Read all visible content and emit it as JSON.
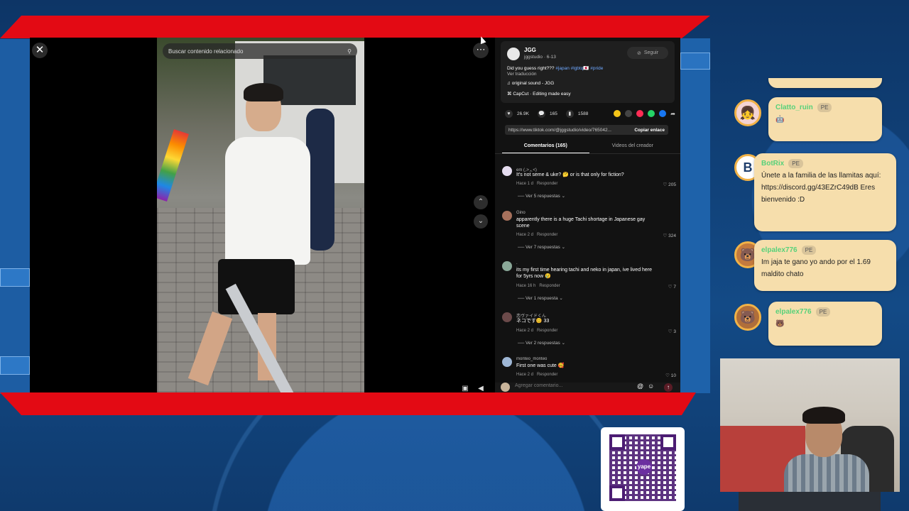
{
  "player": {
    "search_placeholder": "Buscar contenido relacionado",
    "close_icon": "✕",
    "more_icon": "⋯",
    "nav_up_icon": "⌃",
    "nav_down_icon": "⌄"
  },
  "post": {
    "author": "JGG",
    "handle_date": "jggstudio · 6-13",
    "follow_label": "Seguir",
    "caption": "Did you guess right???",
    "hashtags": "#japan #lgbtq🇯🇵 #pride",
    "translate": "Ver traducción",
    "sound": "original sound - JGG",
    "capcut": "CapCut · Editing made easy",
    "likes": "26.9K",
    "comments": "165",
    "saves": "1588",
    "link": "https://www.tiktok.com/@jggstudio/video/765042...",
    "copy_label": "Copiar enlace"
  },
  "tabs": [
    "Comentarios (165)",
    "Videos del creador"
  ],
  "comments": [
    {
      "user": "em (◞˃ᆺ˂)",
      "text": "It's not seme & uke? 🤔 or is that only for fiction?",
      "meta": "Hace 1 d",
      "reply": "Responder",
      "likes": "205",
      "replies": "Ver 5 respuestas"
    },
    {
      "user": "Gino",
      "text": "apparently there is a huge Tachi shortage in Japanese gay scene",
      "meta": "Hace 2 d",
      "reply": "Responder",
      "likes": "324",
      "replies": "Ver 7 respuestas"
    },
    {
      "user": ".",
      "text": "its my first time hearing tachi and neko in japan, ive lived here for 5yrs now 😢",
      "meta": "Hace 16 h",
      "reply": "Responder",
      "likes": "7",
      "replies": "Ver 1 respuesta"
    },
    {
      "user": "恋ヴァイドくん",
      "text": "ネコです😊 33",
      "meta": "Hace 2 d",
      "reply": "Responder",
      "likes": "3",
      "replies": "Ver 2 respuestas"
    },
    {
      "user": "monteo_monteo",
      "text": "First one was cute 🥰",
      "meta": "Hace 2 d",
      "reply": "Responder",
      "likes": "10",
      "replies": ""
    }
  ],
  "comment_input_placeholder": "Agregar comentario...",
  "chat": [
    {
      "user": "Clatto_ruin",
      "badge": "PE",
      "text": "🤖",
      "avatar": "👧"
    },
    {
      "user": "BotRix",
      "badge": "PE",
      "text": "Únete a la familia de las llamitas aquí: https://discord.gg/43EZrC49dB Eres bienvenido :D",
      "avatar": "B"
    },
    {
      "user": "elpalex776",
      "badge": "PE",
      "text": "Im jaja te gano yo ando por el 1.69 maldito chato",
      "avatar": "🐻"
    },
    {
      "user": "elpalex776",
      "badge": "PE",
      "text": "🐻",
      "avatar": "🐻"
    }
  ],
  "qr": {
    "logo": "yape"
  },
  "colors": {
    "brand_red": "#e30a14",
    "chat_bubble": "#f6deac",
    "chat_user": "#57d17a",
    "tiktok_bg": "#121212",
    "tab_accent": "#ffffff"
  }
}
